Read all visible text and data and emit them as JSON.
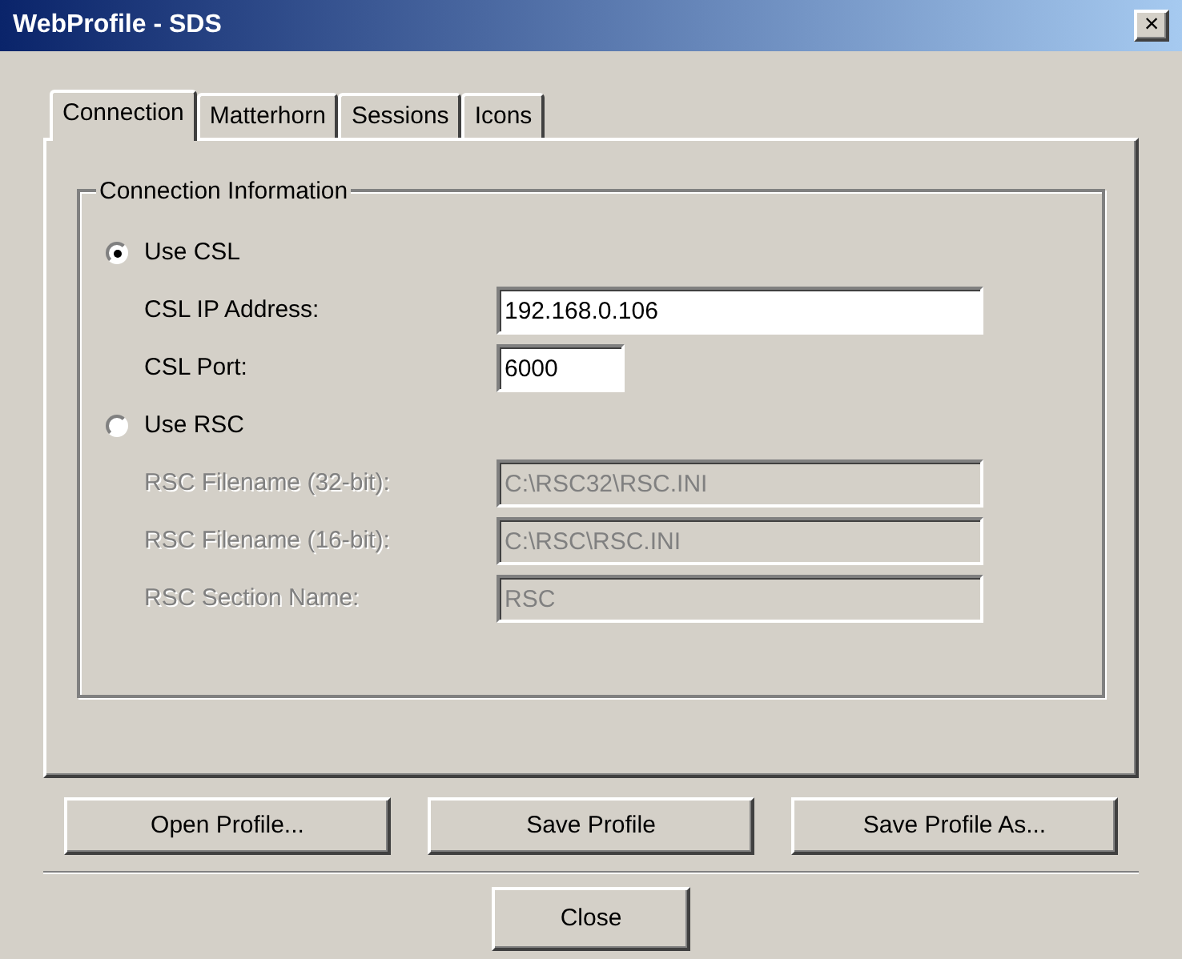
{
  "window": {
    "title": "WebProfile - SDS",
    "close": "×"
  },
  "tabs": [
    {
      "label": "Connection",
      "selected": true
    },
    {
      "label": "Matterhorn",
      "selected": false
    },
    {
      "label": "Sessions",
      "selected": false
    },
    {
      "label": "Icons",
      "selected": false
    }
  ],
  "group": {
    "title": "Connection Information",
    "options": [
      {
        "label": "Use CSL",
        "selected": true,
        "fields": [
          {
            "label": "CSL IP Address:",
            "value": "192.168.0.106",
            "disabled": false,
            "kind": "wide"
          },
          {
            "label": "CSL Port:",
            "value": "6000",
            "disabled": false,
            "kind": "narrow"
          }
        ]
      },
      {
        "label": "Use RSC",
        "selected": false,
        "fields": [
          {
            "label": "RSC Filename (32-bit):",
            "value": "C:\\RSC32\\RSC.INI",
            "disabled": true,
            "kind": "wide"
          },
          {
            "label": "RSC Filename (16-bit):",
            "value": "C:\\RSC\\RSC.INI",
            "disabled": true,
            "kind": "wide"
          },
          {
            "label": "RSC Section Name:",
            "value": "RSC",
            "disabled": true,
            "kind": "wide"
          }
        ]
      }
    ]
  },
  "buttons": [
    "Open Profile...",
    "Save Profile",
    "Save Profile As..."
  ],
  "close_button": "Close"
}
